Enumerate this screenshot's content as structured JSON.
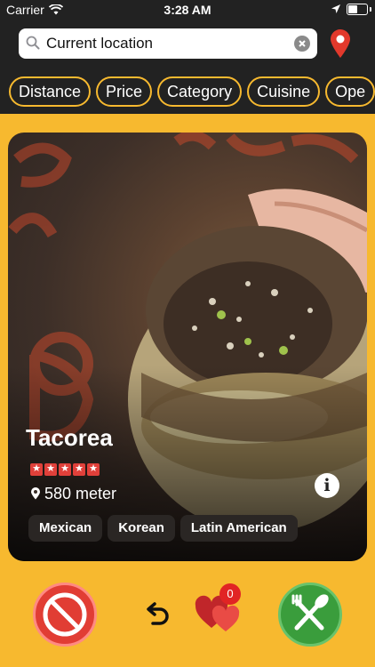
{
  "status_bar": {
    "carrier": "Carrier",
    "time": "3:28 AM"
  },
  "search": {
    "value": "Current location"
  },
  "filters": [
    "Distance",
    "Price",
    "Category",
    "Cuisine",
    "Ope"
  ],
  "restaurant": {
    "name": "Tacorea",
    "rating": 5,
    "distance": "580 meter",
    "tags": [
      "Mexican",
      "Korean",
      "Latin American"
    ]
  },
  "actions": {
    "favorites_count": "0"
  },
  "colors": {
    "accent": "#f7b92f",
    "dislike": "#e13d34",
    "like": "#3a9d3c",
    "badge": "#e12424"
  },
  "icons": [
    "wifi-icon",
    "location-arrow-icon",
    "battery-icon",
    "search-icon",
    "clear-icon",
    "map-pin-icon",
    "star-icon",
    "location-pin-icon",
    "info-icon",
    "no-icon",
    "undo-icon",
    "hearts-icon",
    "fork-spoon-icon"
  ]
}
